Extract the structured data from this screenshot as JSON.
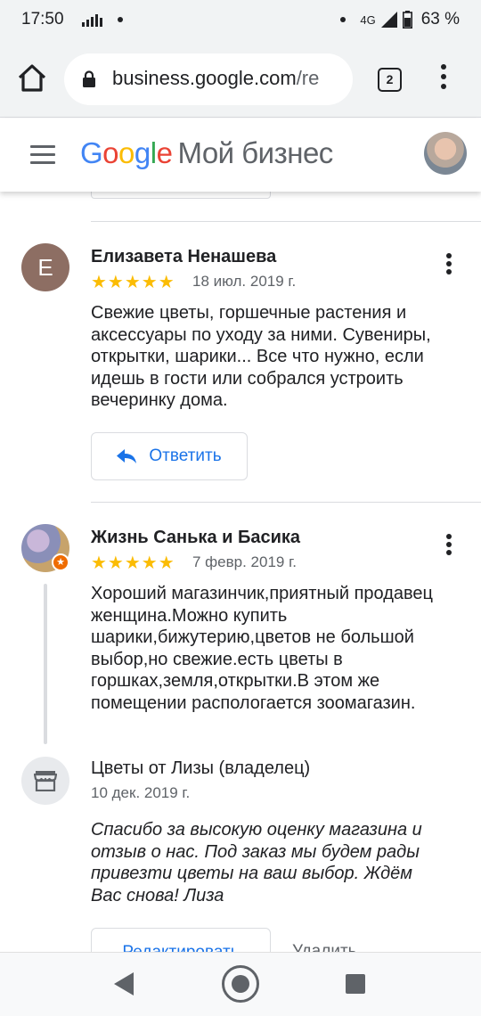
{
  "status_bar": {
    "time": "17:50",
    "network": "4G",
    "battery": "63 %"
  },
  "browser": {
    "url_domain": "business.google.com",
    "url_rest": "/re",
    "tab_count": "2"
  },
  "header": {
    "brand_google": [
      "G",
      "o",
      "o",
      "g",
      "l",
      "e"
    ],
    "product_name": "Мой бизнес"
  },
  "reviews": [
    {
      "avatar_letter": "E",
      "name": "Елизавета Ненашева",
      "stars": "★★★★★",
      "rating": 5,
      "date": "18 июл. 2019 г.",
      "text": "Свежие цветы, горшечные растения и аксессуары по уходу за ними. Сувениры, открытки, шарики... Все что нужно, если идешь в гости или собрался устроить вечеринку дома.",
      "reply_label": "Ответить"
    },
    {
      "name": "Жизнь Санька и Басика",
      "stars": "★★★★★",
      "rating": 5,
      "date": "7 февр. 2019 г.",
      "text": "Хороший магазинчик,приятный продавец женщина.Можно купить шарики,бижутерию,цветов не большой выбор,но свежие.есть цветы в горшках,земля,открытки.В этом же помещении распологается зоомагазин.",
      "owner_reply": {
        "name": "Цветы от Лизы (владелец)",
        "date": "10 дек. 2019 г.",
        "text": "Спасибо за высокую оценку магазина и отзыв о нас. Под заказ мы будем рады привезти цветы на ваш выбор. Ждём Вас снова! Лиза",
        "edit_label": "Редактировать",
        "delete_label": "Удалить"
      }
    }
  ],
  "colors": {
    "accent": "#1a73e8",
    "star": "#fbbc04",
    "avatar_letter_bg": "#8d6e63"
  }
}
